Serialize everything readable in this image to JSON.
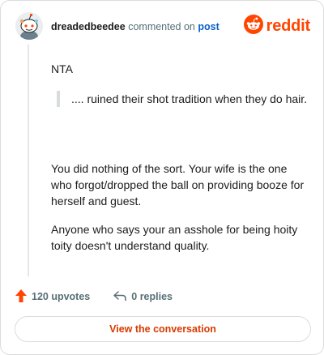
{
  "header": {
    "username": "dreadedbeedee",
    "action_text": "commented on",
    "post_link": "post",
    "brand": "reddit"
  },
  "comment": {
    "first_line": "NTA",
    "quote": ".... ruined their shot tradition when they do hair.",
    "paragraphs": [
      "You did nothing of the sort. Your wife is the one who forgot/dropped the ball on providing booze for herself and guest.",
      "Anyone who says your an asshole for being hoity toity doesn't understand quality."
    ]
  },
  "footer": {
    "upvotes": "120 upvotes",
    "replies": "0 replies"
  },
  "cta": {
    "label": "View the conversation"
  },
  "colors": {
    "brand": "#ff4500",
    "link": "#0a61c6",
    "cta_text": "#d93a00",
    "muted": "#576f76"
  },
  "icons": [
    "snoo-avatar-icon",
    "reddit-logo-icon",
    "upvote-arrow-icon",
    "reply-arrow-icon"
  ]
}
